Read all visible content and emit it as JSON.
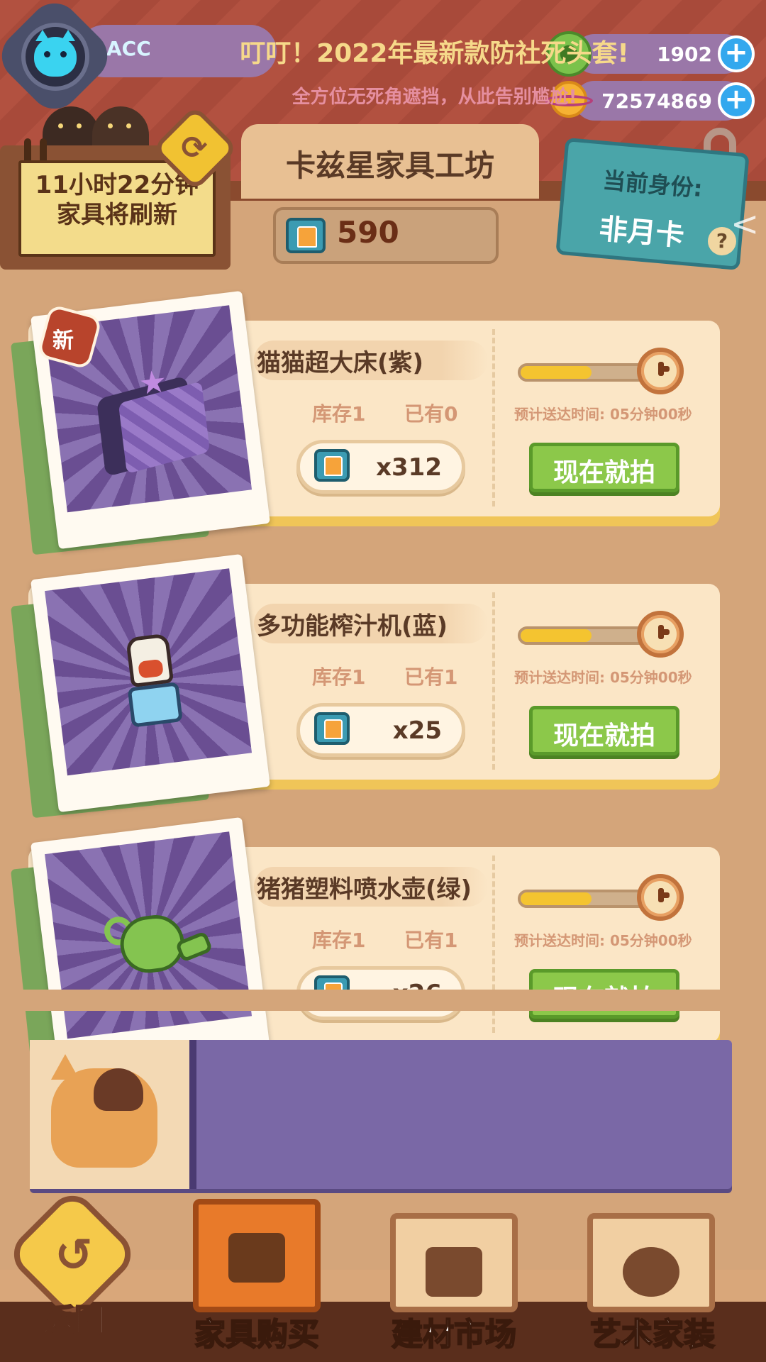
{
  "profile": {
    "name": "ACC"
  },
  "currencies": {
    "gems": "1902",
    "coins": "72574869"
  },
  "refresh": {
    "line1": "11小时22分钟",
    "line2": "家具将刷新"
  },
  "workshop": {
    "title": "卡兹星家具工坊",
    "ticket_balance": "590"
  },
  "identity": {
    "label": "当前身份:",
    "value": "非月卡",
    "help": "?"
  },
  "items": [
    {
      "name": "猫猫超大床(紫)",
      "badge": "新",
      "stock": "库存1",
      "owned": "已有0",
      "price": "x312",
      "eta": "预计送达时间: 05分钟00秒",
      "buy_label": "现在就拍",
      "progress": 0.55
    },
    {
      "name": "多功能榨汁机(蓝)",
      "stock": "库存1",
      "owned": "已有1",
      "price": "x25",
      "eta": "预计送达时间: 05分钟00秒",
      "buy_label": "现在就拍",
      "progress": 0.55
    },
    {
      "name": "猪猪塑料喷水壶(绿)",
      "stock": "库存1",
      "owned": "已有1",
      "price": "x26",
      "eta": "预计送达时间: 05分钟00秒",
      "buy_label": "现在就拍",
      "progress": 0.55
    }
  ],
  "banner": {
    "title": "叮叮！2022年最新款防社死头套!",
    "subtitle": "全方位无死角遮挡，从此告别尴尬!"
  },
  "nav": {
    "back": "返回",
    "tabs": [
      {
        "label": "家具购买",
        "active": true
      },
      {
        "label": "建材市场",
        "active": false
      },
      {
        "label": "艺术家装",
        "active": false
      }
    ]
  },
  "icons": [
    "avatar-cat-icon",
    "gem-icon",
    "coin-planet-icon",
    "plus-icon",
    "refresh-icon",
    "ticket-icon",
    "help-icon",
    "share-icon",
    "clock-icon",
    "back-arrow-icon"
  ],
  "colors": {
    "accent_green": "#8cc84a",
    "header_red": "#b25140",
    "pill_purple": "#9a77a8"
  }
}
